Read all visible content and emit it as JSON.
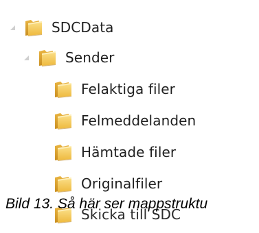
{
  "colors": {
    "folder_front": "#f2c94c",
    "folder_back": "#e0a82e",
    "folder_shadow": "#c8902a",
    "text": "#1e1e1e",
    "arrow": "#c8c8c8"
  },
  "tree": {
    "root": {
      "label": "SDCData",
      "icon": "folder-icon",
      "expander": "expanded-arrow-icon"
    },
    "child": {
      "label": "Sender",
      "icon": "folder-icon",
      "expander": "expanded-arrow-icon"
    },
    "items": [
      {
        "label": "Felaktiga filer",
        "icon": "folder-icon"
      },
      {
        "label": "Felmeddelanden",
        "icon": "folder-icon"
      },
      {
        "label": "Hämtade filer",
        "icon": "folder-icon"
      },
      {
        "label": "Originalfiler",
        "icon": "folder-icon"
      },
      {
        "label": "Skicka till SDC",
        "icon": "folder-icon"
      }
    ]
  },
  "caption": "Bild 13. Så här ser mappstruktu"
}
